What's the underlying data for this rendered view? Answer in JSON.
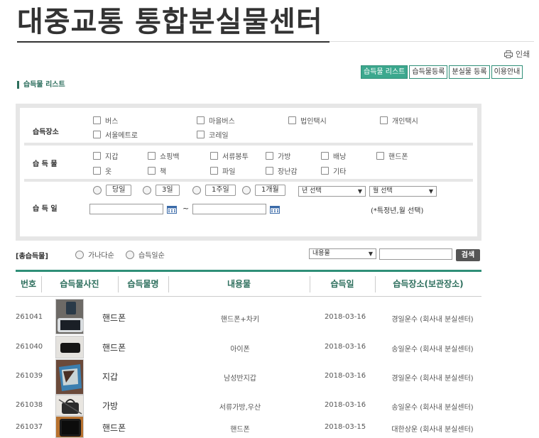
{
  "header": {
    "title": "대중교통 통합분실물센터",
    "print_label": "인쇄"
  },
  "tabs": [
    "습득물 리스트",
    "습득물등록",
    "분실물 등록",
    "이용안내"
  ],
  "section_label": "습득물 리스트",
  "search": {
    "place_label": "습득장소",
    "places": [
      "버스",
      "마을버스",
      "법인택시",
      "개인택시",
      "서울메트로",
      "코레일"
    ],
    "item_label": "습 득 물",
    "items": [
      "지갑",
      "쇼핑백",
      "서류봉투",
      "가방",
      "배낭",
      "핸드폰",
      "옷",
      "책",
      "파일",
      "장난감",
      "기타"
    ],
    "date_label": "습 득 일",
    "periods": [
      "당일",
      "3일",
      "1주일",
      "1개월"
    ],
    "year_select": "년 선택",
    "month_select": "월 선택",
    "tilde": "~",
    "date_hint": "(*특정년,월 선택)"
  },
  "list_controls": {
    "total_label": "[총습득물]",
    "sort_options": [
      "가나다순",
      "습득일순"
    ],
    "field_select": "내용물",
    "search_button": "검색"
  },
  "table": {
    "headers": [
      "번호",
      "습득물사진",
      "습득물명",
      "내용물",
      "습득일",
      "습득장소(보관장소)"
    ],
    "rows": [
      {
        "no": "261041",
        "name": "핸드폰",
        "content": "핸드폰+차키",
        "date": "2018-03-16",
        "place": "경일운수 (회사내 분실센터)",
        "thumb": "phone-photo"
      },
      {
        "no": "261040",
        "name": "핸드폰",
        "content": "아이폰",
        "date": "2018-03-16",
        "place": "송일운수 (회사내 분실센터)",
        "thumb": "phone-photo"
      },
      {
        "no": "261039",
        "name": "지갑",
        "content": "남성반지갑",
        "date": "2018-03-16",
        "place": "경일운수 (회사내 분실센터)",
        "thumb": "wallet-photo"
      },
      {
        "no": "261038",
        "name": "가방",
        "content": "서류가방,우산",
        "date": "2018-03-16",
        "place": "송일운수 (회사내 분실센터)",
        "thumb": "bag-photo"
      },
      {
        "no": "261037",
        "name": "핸드폰",
        "content": "핸드폰",
        "date": "2018-03-15",
        "place": "대한상운 (회사내 분실센터)",
        "thumb": "phone-photo"
      }
    ]
  },
  "colors": {
    "accent": "#3ca88e",
    "accent_dark": "#2f8f78",
    "heading": "#2c6e5c"
  }
}
